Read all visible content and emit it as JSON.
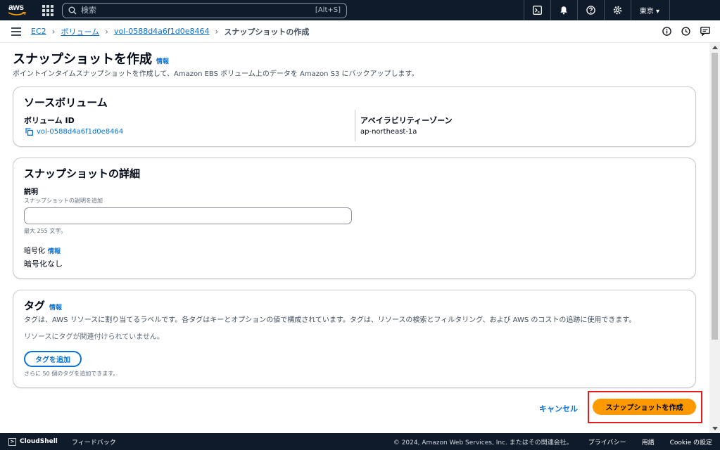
{
  "topnav": {
    "logo": "aws",
    "search_placeholder": "検索",
    "search_shortcut": "[Alt+S]",
    "region": "東京 ▾"
  },
  "breadcrumb": {
    "items": [
      "EC2",
      "ボリューム",
      "vol-0588d4a6f1d0e8464"
    ],
    "current": "スナップショットの作成"
  },
  "page": {
    "title": "スナップショットを作成",
    "info": "情報",
    "description": "ポイントインタイムスナップショットを作成して、Amazon EBS ボリューム上のデータを Amazon S3 にバックアップします。"
  },
  "source_volume": {
    "heading": "ソースボリューム",
    "volume_id_label": "ボリューム ID",
    "volume_id": "vol-0588d4a6f1d0e8464",
    "az_label": "アベイラビリティーゾーン",
    "az_value": "ap-northeast-1a"
  },
  "details": {
    "heading": "スナップショットの詳細",
    "description_label": "説明",
    "description_hint": "スナップショットの説明を追加",
    "description_value": "",
    "description_constraint": "最大 255 文字。",
    "encryption_label": "暗号化",
    "encryption_info": "情報",
    "encryption_value": "暗号化なし"
  },
  "tags": {
    "heading": "タグ",
    "info": "情報",
    "description": "タグは、AWS リソースに割り当てるラベルです。各タグはキーとオプションの値で構成されています。タグは、リソースの検索とフィルタリング、および AWS のコストの追跡に使用できます。",
    "empty": "リソースにタグが関連付けられていません。",
    "add_button": "タグを追加",
    "remaining": "さらに 50 個のタグを追加できます。"
  },
  "actions": {
    "cancel": "キャンセル",
    "create": "スナップショットを作成"
  },
  "footer": {
    "cloudshell": "CloudShell",
    "feedback": "フィードバック",
    "copyright": "© 2024, Amazon Web Services, Inc. またはその関連会社。",
    "privacy": "プライバシー",
    "terms": "用語",
    "cookie": "Cookie の設定"
  },
  "colors": {
    "nav_bg": "#0f1b2a",
    "link": "#0972d3",
    "primary": "#ff9900",
    "highlight": "#e21d1d"
  }
}
